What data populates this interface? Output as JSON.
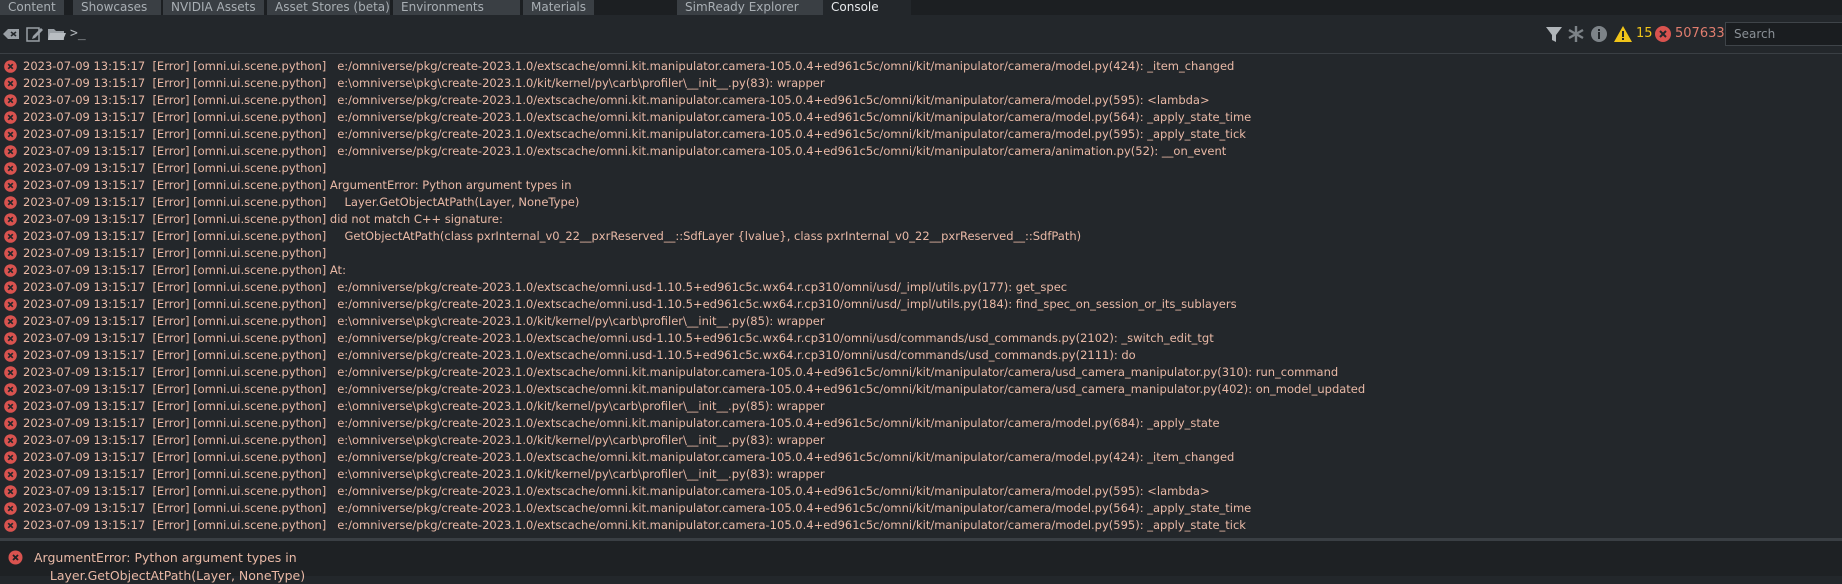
{
  "tabs": [
    {
      "label": "Content",
      "active": false
    },
    {
      "label": "Showcases",
      "active": false
    },
    {
      "label": "NVIDIA Assets",
      "active": false
    },
    {
      "label": "Asset Stores (beta)",
      "active": false
    },
    {
      "label": "Environments",
      "active": false
    },
    {
      "label": "Materials",
      "active": false
    },
    {
      "label": "SimReady Explorer",
      "active": false
    },
    {
      "label": "Console",
      "active": true
    }
  ],
  "toolbar": {
    "prompt": ">_",
    "warning_count": "15",
    "error_count": "507633",
    "search_placeholder": "Search"
  },
  "log_rows": [
    "2023-07-09 13:15:17  [Error] [omni.ui.scene.python]   e:/omniverse/pkg/create-2023.1.0/extscache/omni.kit.manipulator.camera-105.0.4+ed961c5c/omni/kit/manipulator/camera/model.py(424): _item_changed",
    "2023-07-09 13:15:17  [Error] [omni.ui.scene.python]   e:\\omniverse\\pkg\\create-2023.1.0/kit/kernel/py\\carb\\profiler\\__init__.py(83): wrapper",
    "2023-07-09 13:15:17  [Error] [omni.ui.scene.python]   e:/omniverse/pkg/create-2023.1.0/extscache/omni.kit.manipulator.camera-105.0.4+ed961c5c/omni/kit/manipulator/camera/model.py(595): <lambda>",
    "2023-07-09 13:15:17  [Error] [omni.ui.scene.python]   e:/omniverse/pkg/create-2023.1.0/extscache/omni.kit.manipulator.camera-105.0.4+ed961c5c/omni/kit/manipulator/camera/model.py(564): _apply_state_time",
    "2023-07-09 13:15:17  [Error] [omni.ui.scene.python]   e:/omniverse/pkg/create-2023.1.0/extscache/omni.kit.manipulator.camera-105.0.4+ed961c5c/omni/kit/manipulator/camera/model.py(595): _apply_state_tick",
    "2023-07-09 13:15:17  [Error] [omni.ui.scene.python]   e:/omniverse/pkg/create-2023.1.0/extscache/omni.kit.manipulator.camera-105.0.4+ed961c5c/omni/kit/manipulator/camera/animation.py(52): __on_event",
    "2023-07-09 13:15:17  [Error] [omni.ui.scene.python]",
    "2023-07-09 13:15:17  [Error] [omni.ui.scene.python] ArgumentError: Python argument types in",
    "2023-07-09 13:15:17  [Error] [omni.ui.scene.python]     Layer.GetObjectAtPath(Layer, NoneType)",
    "2023-07-09 13:15:17  [Error] [omni.ui.scene.python] did not match C++ signature:",
    "2023-07-09 13:15:17  [Error] [omni.ui.scene.python]     GetObjectAtPath(class pxrInternal_v0_22__pxrReserved__::SdfLayer {lvalue}, class pxrInternal_v0_22__pxrReserved__::SdfPath)",
    "2023-07-09 13:15:17  [Error] [omni.ui.scene.python]",
    "2023-07-09 13:15:17  [Error] [omni.ui.scene.python] At:",
    "2023-07-09 13:15:17  [Error] [omni.ui.scene.python]   e:/omniverse/pkg/create-2023.1.0/extscache/omni.usd-1.10.5+ed961c5c.wx64.r.cp310/omni/usd/_impl/utils.py(177): get_spec",
    "2023-07-09 13:15:17  [Error] [omni.ui.scene.python]   e:/omniverse/pkg/create-2023.1.0/extscache/omni.usd-1.10.5+ed961c5c.wx64.r.cp310/omni/usd/_impl/utils.py(184): find_spec_on_session_or_its_sublayers",
    "2023-07-09 13:15:17  [Error] [omni.ui.scene.python]   e:\\omniverse\\pkg\\create-2023.1.0/kit/kernel/py\\carb\\profiler\\__init__.py(85): wrapper",
    "2023-07-09 13:15:17  [Error] [omni.ui.scene.python]   e:/omniverse/pkg/create-2023.1.0/extscache/omni.usd-1.10.5+ed961c5c.wx64.r.cp310/omni/usd/commands/usd_commands.py(2102): _switch_edit_tgt",
    "2023-07-09 13:15:17  [Error] [omni.ui.scene.python]   e:/omniverse/pkg/create-2023.1.0/extscache/omni.usd-1.10.5+ed961c5c.wx64.r.cp310/omni/usd/commands/usd_commands.py(2111): do",
    "2023-07-09 13:15:17  [Error] [omni.ui.scene.python]   e:/omniverse/pkg/create-2023.1.0/extscache/omni.kit.manipulator.camera-105.0.4+ed961c5c/omni/kit/manipulator/camera/usd_camera_manipulator.py(310): run_command",
    "2023-07-09 13:15:17  [Error] [omni.ui.scene.python]   e:/omniverse/pkg/create-2023.1.0/extscache/omni.kit.manipulator.camera-105.0.4+ed961c5c/omni/kit/manipulator/camera/usd_camera_manipulator.py(402): on_model_updated",
    "2023-07-09 13:15:17  [Error] [omni.ui.scene.python]   e:\\omniverse\\pkg\\create-2023.1.0/kit/kernel/py\\carb\\profiler\\__init__.py(85): wrapper",
    "2023-07-09 13:15:17  [Error] [omni.ui.scene.python]   e:/omniverse/pkg/create-2023.1.0/extscache/omni.kit.manipulator.camera-105.0.4+ed961c5c/omni/kit/manipulator/camera/model.py(684): _apply_state",
    "2023-07-09 13:15:17  [Error] [omni.ui.scene.python]   e:\\omniverse\\pkg\\create-2023.1.0/kit/kernel/py\\carb\\profiler\\__init__.py(83): wrapper",
    "2023-07-09 13:15:17  [Error] [omni.ui.scene.python]   e:/omniverse/pkg/create-2023.1.0/extscache/omni.kit.manipulator.camera-105.0.4+ed961c5c/omni/kit/manipulator/camera/model.py(424): _item_changed",
    "2023-07-09 13:15:17  [Error] [omni.ui.scene.python]   e:\\omniverse\\pkg\\create-2023.1.0/kit/kernel/py\\carb\\profiler\\__init__.py(83): wrapper",
    "2023-07-09 13:15:17  [Error] [omni.ui.scene.python]   e:/omniverse/pkg/create-2023.1.0/extscache/omni.kit.manipulator.camera-105.0.4+ed961c5c/omni/kit/manipulator/camera/model.py(595): <lambda>",
    "2023-07-09 13:15:17  [Error] [omni.ui.scene.python]   e:/omniverse/pkg/create-2023.1.0/extscache/omni.kit.manipulator.camera-105.0.4+ed961c5c/omni/kit/manipulator/camera/model.py(564): _apply_state_time",
    "2023-07-09 13:15:17  [Error] [omni.ui.scene.python]   e:/omniverse/pkg/create-2023.1.0/extscache/omni.kit.manipulator.camera-105.0.4+ed961c5c/omni/kit/manipulator/camera/model.py(595): _apply_state_tick"
  ],
  "detail": {
    "line1": "ArgumentError: Python argument types in",
    "line2": "    Layer.GetObjectAtPath(Layer, NoneType)"
  },
  "colors": {
    "background": "#23272b",
    "tab": "#3a3f44",
    "error_icon": "#d9534f",
    "error_text": "#e9b9a6",
    "warning_icon": "#f0c419"
  },
  "icons": [
    "clear-icon",
    "edit-icon",
    "folder-icon",
    "filter-icon",
    "verbose-icon",
    "info-icon",
    "warning-icon",
    "error-icon"
  ]
}
